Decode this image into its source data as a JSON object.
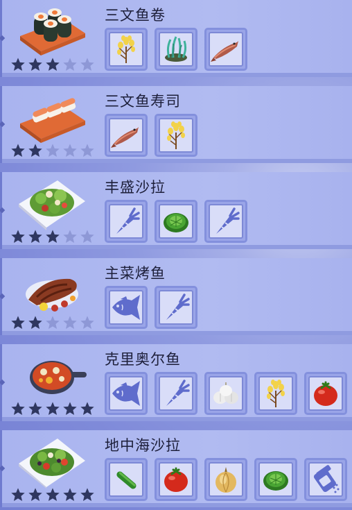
{
  "colors": {
    "star_filled": "#2f3760",
    "star_empty": "#8e98d6",
    "silhouette": "#5f6ccc"
  },
  "recipes": [
    {
      "name": "三文鱼卷",
      "stars": 3,
      "dish_icon": "salmon-roll-icon",
      "ingredients": [
        "rice-plant-icon",
        "seaweed-icon",
        "salmon-icon"
      ]
    },
    {
      "name": "三文鱼寿司",
      "stars": 2,
      "dish_icon": "salmon-sushi-icon",
      "ingredients": [
        "salmon-icon",
        "rice-plant-icon"
      ]
    },
    {
      "name": "丰盛沙拉",
      "stars": 3,
      "dish_icon": "salad-icon",
      "ingredients": [
        "vegetable-silhouette-icon",
        "lettuce-icon",
        "vegetable-silhouette-icon"
      ]
    },
    {
      "name": "主菜烤鱼",
      "stars": 2,
      "dish_icon": "grilled-fish-icon",
      "ingredients": [
        "fish-silhouette-icon",
        "vegetable-silhouette-icon"
      ]
    },
    {
      "name": "克里奥尔鱼",
      "stars": 5,
      "dish_icon": "creole-fish-icon",
      "ingredients": [
        "fish-silhouette-icon",
        "vegetable-silhouette-icon",
        "garlic-icon",
        "rice-plant-icon",
        "tomato-icon"
      ]
    },
    {
      "name": "地中海沙拉",
      "stars": 5,
      "dish_icon": "mediterranean-salad-icon",
      "ingredients": [
        "cucumber-icon",
        "tomato-icon",
        "onion-icon",
        "lettuce-icon",
        "spice-silhouette-icon"
      ]
    }
  ]
}
